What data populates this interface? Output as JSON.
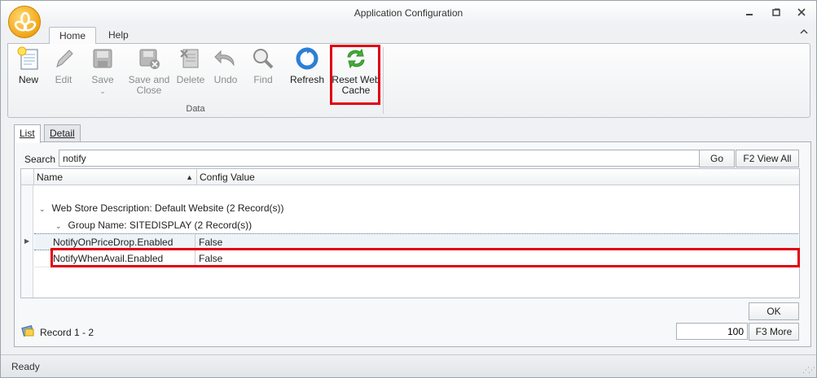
{
  "window": {
    "title": "Application Configuration"
  },
  "ribbon_tabs": [
    {
      "label": "Home"
    },
    {
      "label": "Help"
    }
  ],
  "ribbon": {
    "buttons": {
      "new": "New",
      "edit": "Edit",
      "save": "Save",
      "save_close_1": "Save and",
      "save_close_2": "Close",
      "delete": "Delete",
      "undo": "Undo",
      "find": "Find",
      "refresh": "Refresh",
      "reset_cache_1": "Reset Web",
      "reset_cache_2": "Cache"
    },
    "group_label": "Data"
  },
  "page_tabs": [
    {
      "label": "List"
    },
    {
      "label": "Detail"
    }
  ],
  "search": {
    "label": "Search",
    "value": "notify",
    "go": "Go",
    "view_all": "F2 View All"
  },
  "grid": {
    "columns": [
      "Name",
      "Config Value"
    ],
    "group1": "Web Store Description: Default Website (2 Record(s))",
    "group2": "Group Name: SITEDISPLAY (2 Record(s))",
    "rows": [
      {
        "name": "NotifyOnPriceDrop.Enabled",
        "value": "False"
      },
      {
        "name": "NotifyWhenAvail.Enabled",
        "value": "False"
      }
    ]
  },
  "footer": {
    "ok": "OK",
    "record_text": "Record 1 - 2",
    "page_size": "100",
    "more": "F3 More"
  },
  "status": {
    "text": "Ready"
  },
  "colors": {
    "highlight": "#e0000f",
    "orb": "#f2a516"
  }
}
